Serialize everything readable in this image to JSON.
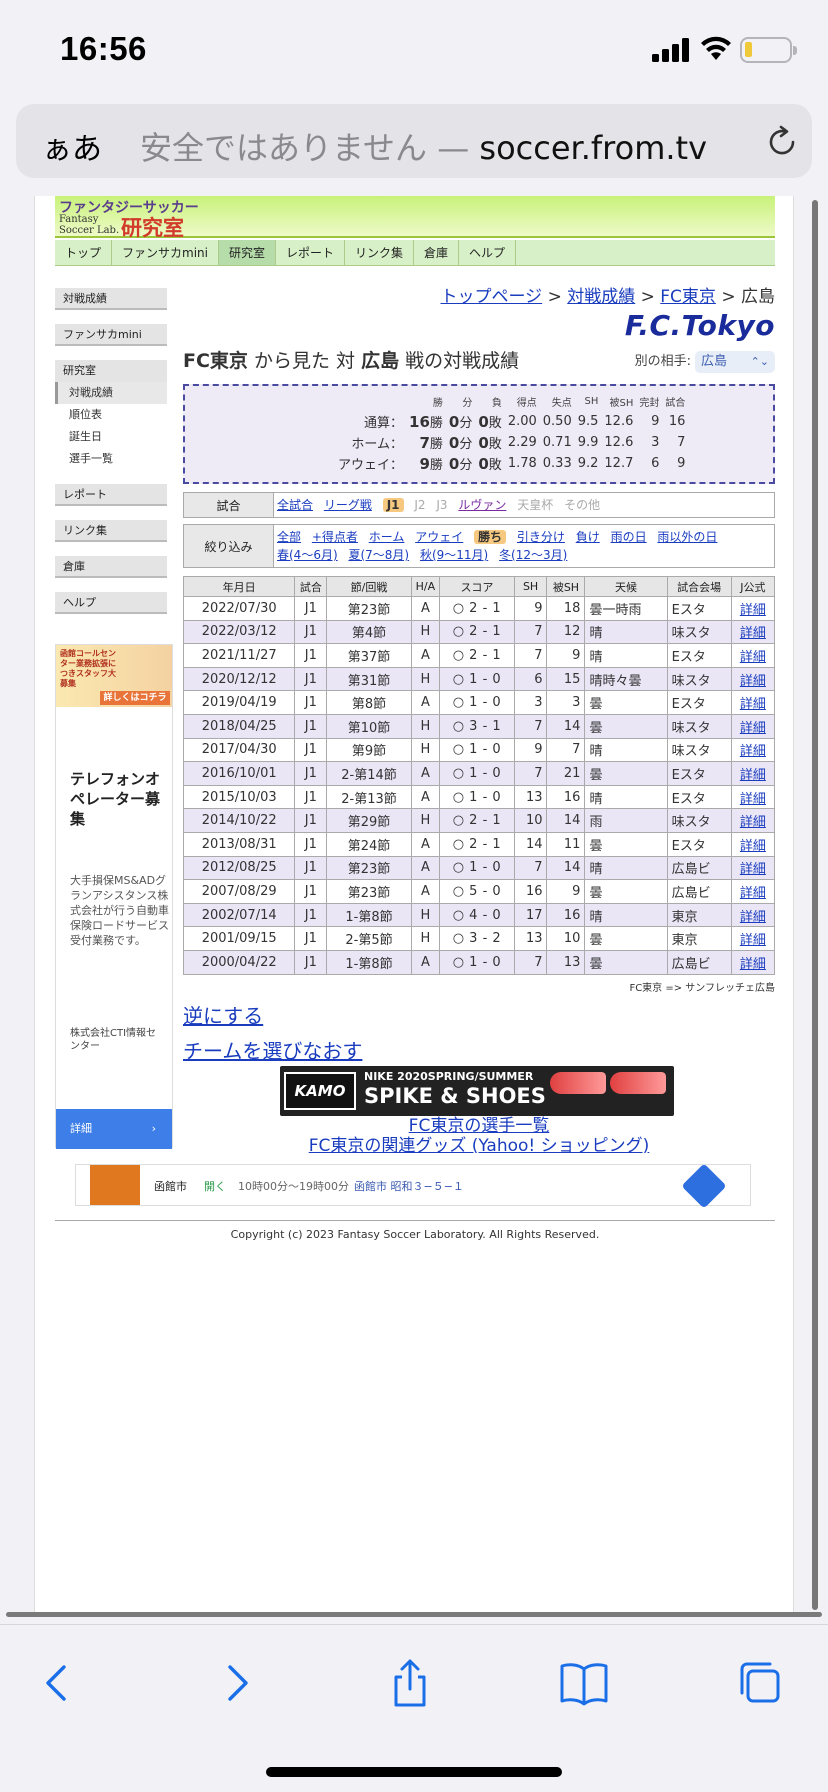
{
  "status": {
    "time": "16:56"
  },
  "browser": {
    "aa_label": "ぁあ",
    "url_prefix": "安全ではありません — ",
    "url_host": "soccer.from.tv"
  },
  "site": {
    "logo_jp": "ファンタジーサッカー",
    "logo_en_1": "Fantasy",
    "logo_en_2": "Soccer Lab.",
    "logo_big": "研究室",
    "topnav": [
      "トップ",
      "ファンサカmini",
      "研究室",
      "レポート",
      "リンク集",
      "倉庫",
      "ヘルプ"
    ],
    "topnav_active": 2
  },
  "sidebar": {
    "items": [
      "対戦成績",
      "ファンサカmini"
    ],
    "group_head": "研究室",
    "group_items": [
      "対戦成績",
      "順位表",
      "誕生日",
      "選手一覧"
    ],
    "items2": [
      "レポート",
      "リンク集",
      "倉庫",
      "ヘルプ"
    ]
  },
  "ad_left": {
    "top_text": "函館コールセンター業務拡張につきスタッフ大募集",
    "top_btn": "詳しくはコチラ",
    "title": "テレフォンオペレーター募集",
    "body": "大手損保MS&ADグランアシスタンス株式会社が行う自動車保険ロードサービス受付業務です。",
    "company": "株式会社CTI情報センター",
    "button": "詳細",
    "arrow": "›"
  },
  "breadcrumb": {
    "top": "トップページ",
    "sep": ">",
    "record": "対戦成績",
    "team": "FC東京",
    "current": "広島"
  },
  "team_title": "F.C.Tokyo",
  "headline": {
    "team": "FC東京",
    "mid1": " から見た 対 ",
    "opp": "広島",
    "mid2": " 戦の対戦成績",
    "other_label": "別の相手:",
    "other_value": "広島"
  },
  "summary": {
    "headers": [
      "勝",
      "分",
      "負",
      "得点",
      "失点",
      "SH",
      "被SH",
      "完封",
      "試合"
    ],
    "rows": [
      {
        "label": "通算：",
        "w": "16",
        "wl": "勝",
        "d": "0",
        "dl": "分",
        "l": "0",
        "ll": "敗",
        "gf": "2.00",
        "ga": "0.50",
        "sh": "9.5",
        "osh": "12.6",
        "cs": "9",
        "gp": "16"
      },
      {
        "label": "ホーム：",
        "w": "7",
        "wl": "勝",
        "d": "0",
        "dl": "分",
        "l": "0",
        "ll": "敗",
        "gf": "2.29",
        "ga": "0.71",
        "sh": "9.9",
        "osh": "12.6",
        "cs": "3",
        "gp": "7"
      },
      {
        "label": "アウェイ：",
        "w": "9",
        "wl": "勝",
        "d": "0",
        "dl": "分",
        "l": "0",
        "ll": "敗",
        "gf": "1.78",
        "ga": "0.33",
        "sh": "9.2",
        "osh": "12.7",
        "cs": "6",
        "gp": "9"
      }
    ]
  },
  "filter_match": {
    "label": "試合",
    "opts": [
      {
        "t": "全試合",
        "k": "link"
      },
      {
        "t": "リーグ戦",
        "k": "link"
      },
      {
        "t": "J1",
        "k": "sel"
      },
      {
        "t": "J2",
        "k": "dis"
      },
      {
        "t": "J3",
        "k": "dis"
      },
      {
        "t": "ルヴァン",
        "k": "vis"
      },
      {
        "t": "天皇杯",
        "k": "dis"
      },
      {
        "t": "その他",
        "k": "dis"
      }
    ]
  },
  "filter_narrow": {
    "label": "絞り込み",
    "opts": [
      {
        "t": "全部",
        "k": "link"
      },
      {
        "t": "+得点者",
        "k": "link"
      },
      {
        "t": "ホーム",
        "k": "link"
      },
      {
        "t": "アウェイ",
        "k": "link"
      },
      {
        "t": "勝ち",
        "k": "sel"
      },
      {
        "t": "引き分け",
        "k": "link"
      },
      {
        "t": "負け",
        "k": "link"
      },
      {
        "t": "雨の日",
        "k": "link"
      },
      {
        "t": "雨以外の日",
        "k": "link"
      },
      {
        "t": "春(4〜6月)",
        "k": "link"
      },
      {
        "t": "夏(7〜8月)",
        "k": "link"
      },
      {
        "t": "秋(9〜11月)",
        "k": "link"
      },
      {
        "t": "冬(12〜3月)",
        "k": "link"
      }
    ]
  },
  "results": {
    "headers": [
      "年月日",
      "試合",
      "節/回戦",
      "H/A",
      "スコア",
      "SH",
      "被SH",
      "天候",
      "試合会場",
      "J公式"
    ],
    "detail_label": "詳細",
    "rows": [
      [
        "2022/07/30",
        "J1",
        "第23節",
        "A",
        "○ 2 - 1",
        "9",
        "18",
        "曇一時雨",
        "Eスタ"
      ],
      [
        "2022/03/12",
        "J1",
        "第4節",
        "H",
        "○ 2 - 1",
        "7",
        "12",
        "晴",
        "味スタ"
      ],
      [
        "2021/11/27",
        "J1",
        "第37節",
        "A",
        "○ 2 - 1",
        "7",
        "9",
        "晴",
        "Eスタ"
      ],
      [
        "2020/12/12",
        "J1",
        "第31節",
        "H",
        "○ 1 - 0",
        "6",
        "15",
        "晴時々曇",
        "味スタ"
      ],
      [
        "2019/04/19",
        "J1",
        "第8節",
        "A",
        "○ 1 - 0",
        "3",
        "3",
        "曇",
        "Eスタ"
      ],
      [
        "2018/04/25",
        "J1",
        "第10節",
        "H",
        "○ 3 - 1",
        "7",
        "14",
        "曇",
        "味スタ"
      ],
      [
        "2017/04/30",
        "J1",
        "第9節",
        "H",
        "○ 1 - 0",
        "9",
        "7",
        "晴",
        "味スタ"
      ],
      [
        "2016/10/01",
        "J1",
        "2-第14節",
        "A",
        "○ 1 - 0",
        "7",
        "21",
        "曇",
        "Eスタ"
      ],
      [
        "2015/10/03",
        "J1",
        "2-第13節",
        "A",
        "○ 1 - 0",
        "13",
        "16",
        "晴",
        "Eスタ"
      ],
      [
        "2014/10/22",
        "J1",
        "第29節",
        "H",
        "○ 2 - 1",
        "10",
        "14",
        "雨",
        "味スタ"
      ],
      [
        "2013/08/31",
        "J1",
        "第24節",
        "A",
        "○ 2 - 1",
        "14",
        "11",
        "曇",
        "Eスタ"
      ],
      [
        "2012/08/25",
        "J1",
        "第23節",
        "A",
        "○ 1 - 0",
        "7",
        "14",
        "晴",
        "広島ビ"
      ],
      [
        "2007/08/29",
        "J1",
        "第23節",
        "A",
        "○ 5 - 0",
        "16",
        "9",
        "曇",
        "広島ビ"
      ],
      [
        "2002/07/14",
        "J1",
        "1-第8節",
        "H",
        "○ 4 - 0",
        "17",
        "16",
        "晴",
        "東京"
      ],
      [
        "2001/09/15",
        "J1",
        "2-第5節",
        "H",
        "○ 3 - 2",
        "13",
        "10",
        "曇",
        "東京"
      ],
      [
        "2000/04/22",
        "J1",
        "1-第8節",
        "A",
        "○ 1 - 0",
        "7",
        "13",
        "曇",
        "広島ビ"
      ]
    ]
  },
  "note": "FC東京 => サンフレッチェ広島",
  "links": {
    "reverse": "逆にする",
    "rechoose": "チームを選びなおす",
    "players": "FC東京の選手一覧",
    "goods": "FC東京の関連グッズ (Yahoo! ショッピング)"
  },
  "spike_ad": {
    "shop": "KAMO",
    "line1": "NIKE 2020SPRING/SUMMER",
    "line2": "SPIKE & SHOES"
  },
  "map_ad": {
    "city": "函館市",
    "open": "開く",
    "hours": "10時00分〜19時00分",
    "address": "函館市 昭和３−５−１"
  },
  "copyright": "Copyright (c) 2023 Fantasy Soccer Laboratory. All Rights Reserved.",
  "colors": {
    "accent_link": "#1a3dbf",
    "title_blue": "#1a2c9c",
    "alt_row": "#eae6f6",
    "selected_chip": "#f6c880"
  }
}
